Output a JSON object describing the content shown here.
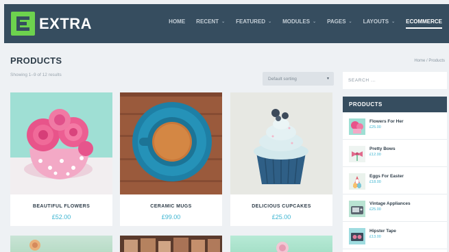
{
  "header": {
    "logo_text": "EXTRA",
    "nav": [
      {
        "label": "HOME",
        "dropdown": false
      },
      {
        "label": "RECENT",
        "dropdown": true
      },
      {
        "label": "FEATURED",
        "dropdown": true
      },
      {
        "label": "MODULES",
        "dropdown": true
      },
      {
        "label": "PAGES",
        "dropdown": true
      },
      {
        "label": "LAYOUTS",
        "dropdown": true
      },
      {
        "label": "ECOMMERCE",
        "dropdown": false,
        "active": true
      }
    ]
  },
  "page": {
    "title": "PRODUCTS",
    "breadcrumb": "Home / Products",
    "result_count": "Showing 1–9 of 12 results",
    "sorting": "Default sorting"
  },
  "products": [
    {
      "name": "BEAUTIFUL FLOWERS",
      "price": "£52.00",
      "image": "pink-roses-in-teacup"
    },
    {
      "name": "CERAMIC MUGS",
      "price": "£99.00",
      "image": "blue-coffee-cup-on-wood"
    },
    {
      "name": "DELICIOUS CUPCAKES",
      "price": "£25.00",
      "image": "blue-frosted-cupcake"
    }
  ],
  "sidebar": {
    "search_placeholder": "SEARCH ...",
    "widget_title": "PRODUCTS",
    "items": [
      {
        "name": "Flowers For Her",
        "price": "£25.00"
      },
      {
        "name": "Pretty Bows",
        "price": "£12.00"
      },
      {
        "name": "Eggs For Easter",
        "price": "£18.00"
      },
      {
        "name": "Vintage Appliances",
        "price": "£25.00"
      },
      {
        "name": "Hipster Tape",
        "price": "£13.00"
      }
    ]
  },
  "colors": {
    "header_bg": "#364d5f",
    "logo_green": "#6dd24e",
    "price_blue": "#3bb4d1",
    "page_bg": "#eef1f4"
  }
}
